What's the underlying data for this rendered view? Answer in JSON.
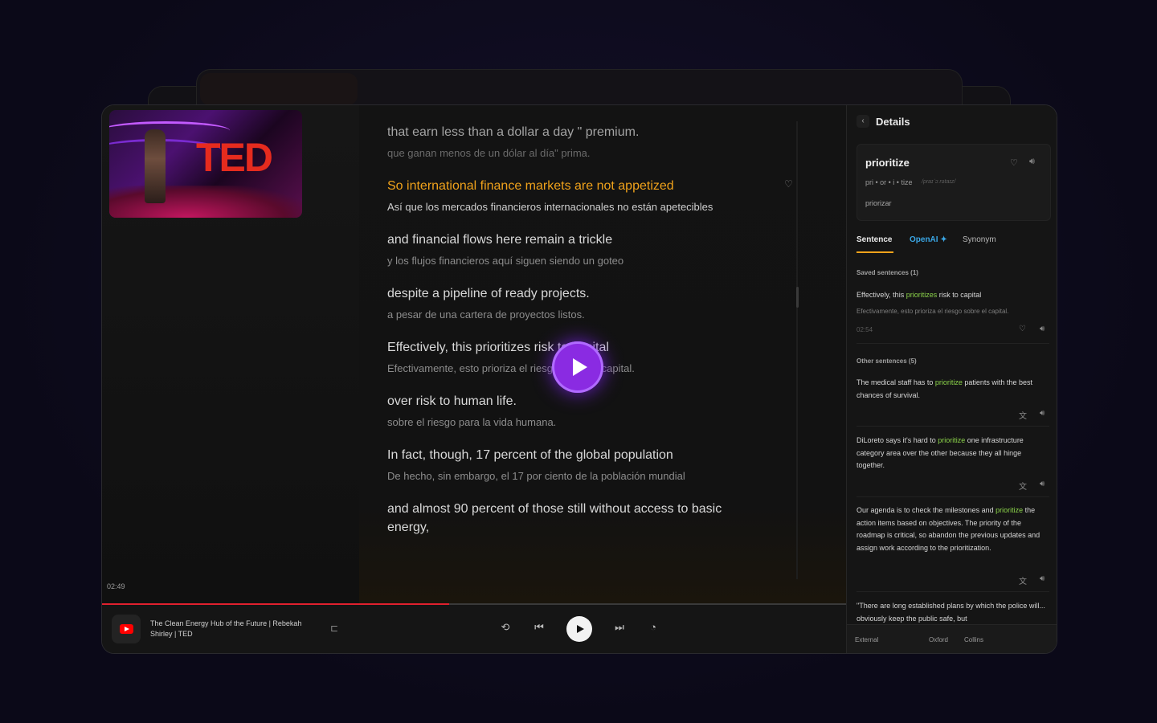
{
  "player": {
    "timestamp": "02:49",
    "progress_fraction": 0.467,
    "video_title": "The Clean Energy Hub of the Future | Rebekah Shirley | TED",
    "video_brand_text": "TED"
  },
  "transcript": [
    {
      "en": "that earn less than a dollar a day \" premium.",
      "es": "que ganan menos de un dólar al día\" prima.",
      "state": "dim"
    },
    {
      "en": "So international finance markets are not appetized",
      "es": "Así que los mercados financieros internacionales no están apetecibles",
      "state": "active"
    },
    {
      "en": "and financial flows here remain a trickle",
      "es": "y los flujos financieros aquí siguen siendo un goteo",
      "state": "normal"
    },
    {
      "en": "despite a pipeline of ready projects.",
      "es": "a pesar de una cartera de proyectos listos.",
      "state": "normal"
    },
    {
      "en": "Effectively, this prioritizes risk to capital",
      "es": "Efectivamente, esto prioriza el riesgo sobre el capital.",
      "state": "normal"
    },
    {
      "en": "over risk to human life.",
      "es": "sobre el riesgo para la vida humana.",
      "state": "normal"
    },
    {
      "en": "In fact, though, 17 percent of the global population",
      "es": "De hecho, sin embargo, el 17 por ciento de la población mundial",
      "state": "normal"
    },
    {
      "en": "and almost 90 percent of those still without access to basic energy,",
      "es": "",
      "state": "normal"
    }
  ],
  "details": {
    "title": "Details",
    "word": "prioritize",
    "syllables": "pri • or • i • tize",
    "ipa": "/praɪˈɔːrətaɪz/",
    "translation": "priorizar",
    "tabs": [
      "Sentence",
      "OpenAI ✦",
      "Synonym"
    ],
    "saved_label": "Saved sentences (1)",
    "saved": {
      "pre": "Effectively, this ",
      "hl": "prioritizes",
      "post": " risk to capital",
      "translation": "Efectivamente, esto prioriza el riesgo sobre el capital.",
      "time": "02:54"
    },
    "other_label": "Other sentences (5)",
    "others": [
      {
        "pre": "The medical staff has to ",
        "hl": "prioritize",
        "post": " patients with the best chances of survival."
      },
      {
        "pre": "DiLoreto says it's hard to ",
        "hl": "prioritize",
        "post": " one infrastructure category area over the other because they all hinge together."
      },
      {
        "pre": "Our agenda is to check the milestones and ",
        "hl": "prioritize",
        "post": " the action items based on objectives. The priority of the roadmap is critical, so abandon the previous updates and assign work according to the prioritization."
      },
      {
        "pre": "\"There are long established plans by which the police will... obviously keep the public safe, but",
        "hl": "",
        "post": ""
      }
    ],
    "footer": [
      "External",
      "Oxford",
      "Collins"
    ]
  },
  "colors": {
    "active_line": "#f0a21b",
    "highlight": "#8bd34a",
    "accent_purple": "#8a2be2",
    "progress_red": "#e0202e"
  }
}
